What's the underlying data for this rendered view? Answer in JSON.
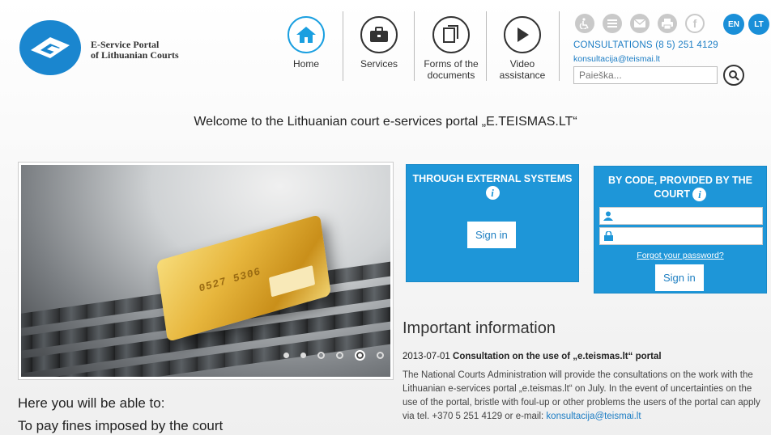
{
  "header": {
    "logo_line1": "E-Service Portal",
    "logo_line2": "of Lithuanian Courts",
    "nav": [
      {
        "label": "Home",
        "icon": "home-icon"
      },
      {
        "label": "Services",
        "icon": "briefcase-icon"
      },
      {
        "label_line1": "Forms of the",
        "label_line2": "documents",
        "icon": "documents-icon"
      },
      {
        "label_line1": "Video",
        "label_line2": "assistance",
        "icon": "play-icon"
      }
    ],
    "utility_icons": [
      "accessibility-icon",
      "list-icon",
      "email-icon",
      "print-icon",
      "facebook-icon"
    ],
    "languages": [
      "EN",
      "LT"
    ],
    "consultations": "CONSULTATIONS (8 5) 251 4129",
    "email": "konsultacija@teismai.lt",
    "search_placeholder": "Paieška..."
  },
  "welcome": "Welcome to the Lithuanian court e-services portal „E.TEISMAS.LT“",
  "carousel": {
    "card_text": "0527 5306",
    "slides": 6,
    "active_slide": 5
  },
  "intro": {
    "line1": "Here you will be able to:",
    "line2": "To pay fines imposed by the court"
  },
  "external": {
    "title": "THROUGH EXTERNAL SYSTEMS",
    "button": "Sign in"
  },
  "code": {
    "title_line1": "BY CODE, PROVIDED BY THE",
    "title_line2": "COURT",
    "forgot": "Forgot your password?",
    "button": "Sign in"
  },
  "important": {
    "title": "Important information",
    "date": "2013-07-01",
    "headline": "Consultation on the use of „e.teismas.lt“ portal",
    "body": "The National Courts Administration will provide the consultations on the work with the Lithuanian e-services portal „e.teismas.lt“ on July. In the event of uncertainties on the use of the portal, bristle with foul-up or other problems the users of the portal can apply via tel. +370 5 251 4129 or e-mail:",
    "email": "konsultacija@teismai.lt"
  },
  "colors": {
    "accent": "#1e96d8",
    "link": "#1a7cc4"
  }
}
